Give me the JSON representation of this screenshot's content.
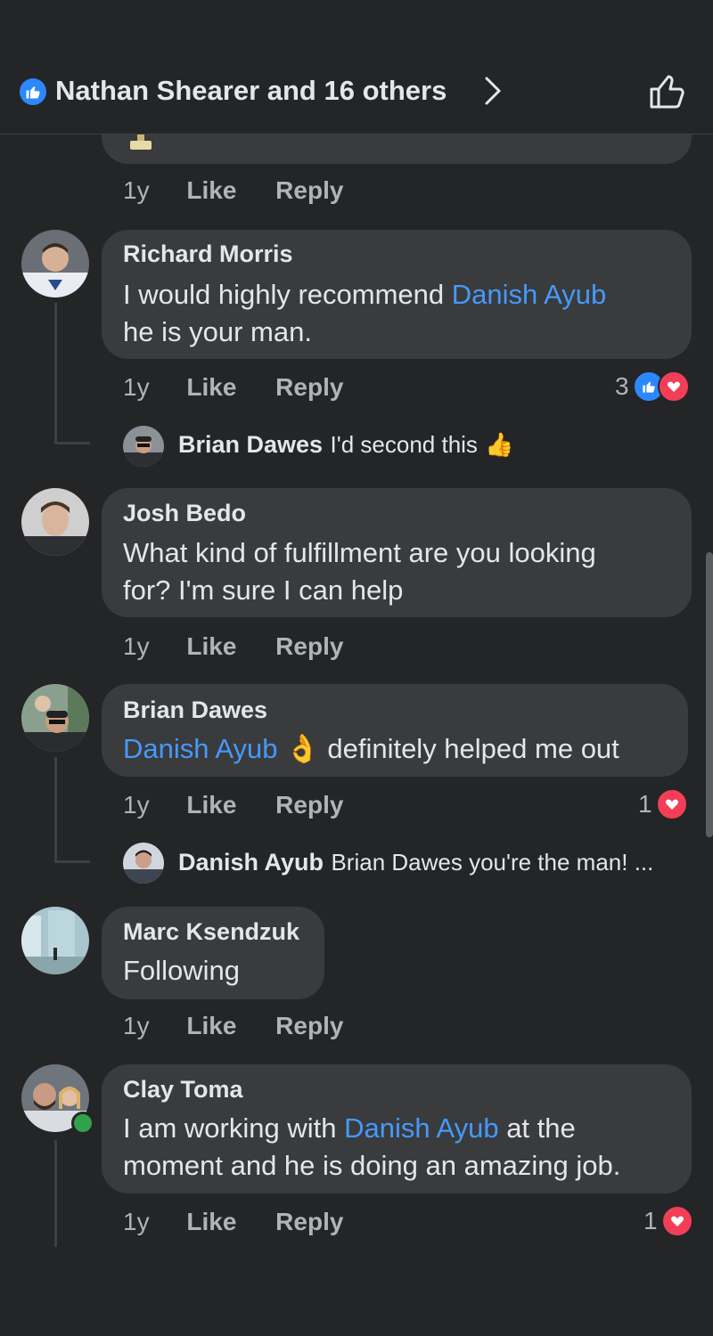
{
  "header": {
    "likers_text": "Nathan Shearer and 16 others",
    "chevron_icon": "chevron-right-icon",
    "like_icon": "thumbs-up-outline-icon"
  },
  "colors": {
    "background": "#242526",
    "bubble": "#3a3b3c",
    "mention": "#4599ff",
    "like": "#2d88ff",
    "love": "#f33e58"
  },
  "top_comment": {
    "time": "1y",
    "like": "Like",
    "reply": "Reply"
  },
  "comments": [
    {
      "author": "Richard Morris",
      "line1_pre": "I would highly recommend ",
      "line1_mention": "Danish Ayub",
      "line2": "he is your man.",
      "time": "1y",
      "like": "Like",
      "reply": "Reply",
      "reaction_count": "3",
      "reactions": [
        "like",
        "love"
      ],
      "reply_preview": {
        "author": "Brian Dawes",
        "text": "I'd second this",
        "emoji": "👍"
      }
    },
    {
      "author": "Josh Bedo",
      "line1": "What kind of fulfillment are you looking",
      "line2": "for? I'm sure I can help",
      "time": "1y",
      "like": "Like",
      "reply": "Reply"
    },
    {
      "author": "Brian Dawes",
      "line1_mention": "Danish Ayub",
      "line1_emoji": "👌",
      "line1_post": " definitely helped me out",
      "time": "1y",
      "like": "Like",
      "reply": "Reply",
      "reaction_count": "1",
      "reactions": [
        "love"
      ],
      "reply_preview": {
        "author": "Danish Ayub",
        "text": "Brian Dawes you're the man! ..."
      }
    },
    {
      "author": "Marc Ksendzuk",
      "line1": "Following",
      "time": "1y",
      "like": "Like",
      "reply": "Reply"
    },
    {
      "author": "Clay Toma",
      "line1_pre": "I am working with ",
      "line1_mention": "Danish Ayub",
      "line1_post": " at the",
      "line2": "moment and he is doing an amazing job.",
      "time": "1y",
      "like": "Like",
      "reply": "Reply",
      "reaction_count": "1",
      "reactions": [
        "love"
      ]
    }
  ]
}
